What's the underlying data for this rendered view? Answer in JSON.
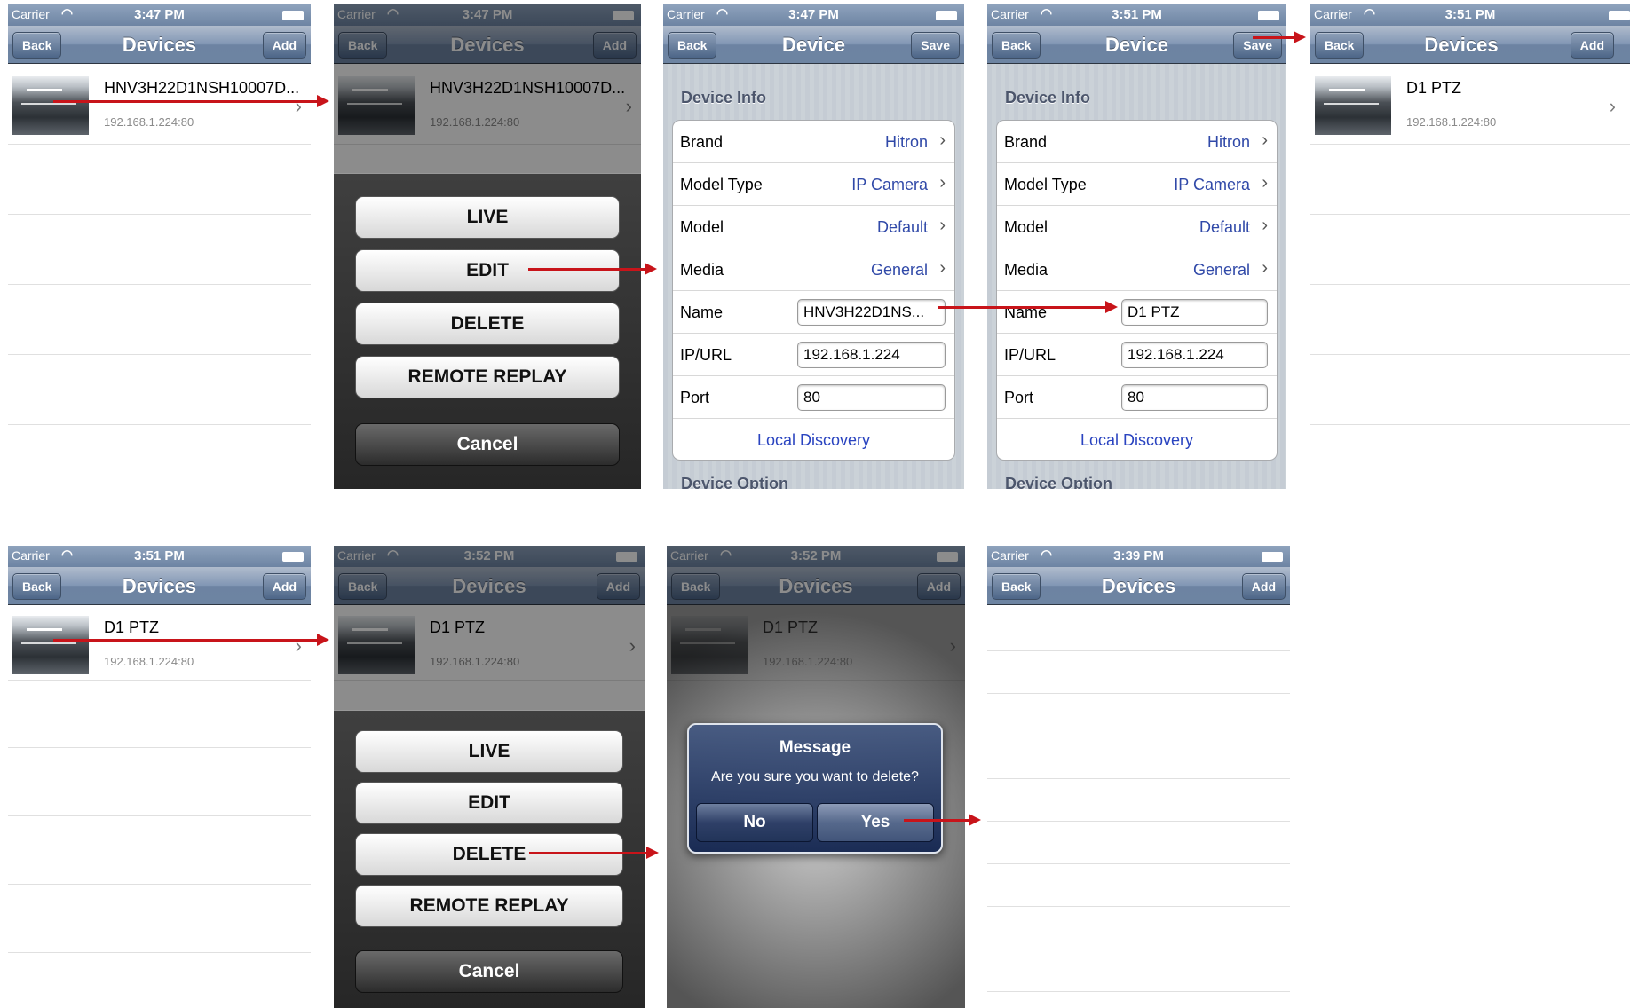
{
  "status": {
    "carrier": "Carrier",
    "wifi_icon": "wifi-icon",
    "battery_icon": "battery-icon"
  },
  "nav": {
    "back": "Back",
    "add": "Add",
    "save": "Save",
    "devices_title": "Devices",
    "device_title": "Device"
  },
  "times": {
    "t347": "3:47 PM",
    "t351": "3:51 PM",
    "t352": "3:52 PM",
    "t339": "3:39 PM"
  },
  "devices": {
    "original_name": "HNV3H22D1NSH10007D...",
    "renamed": "D1 PTZ",
    "ip": "192.168.1.224:80"
  },
  "action_sheet": {
    "live": "LIVE",
    "edit": "EDIT",
    "delete": "DELETE",
    "remote_replay": "REMOTE REPLAY",
    "cancel": "Cancel"
  },
  "form": {
    "section_info": "Device Info",
    "section_option": "Device Option",
    "brand_label": "Brand",
    "brand_value": "Hitron",
    "model_type_label": "Model Type",
    "model_type_value": "IP Camera",
    "model_label": "Model",
    "model_value": "Default",
    "media_label": "Media",
    "media_value": "General",
    "name_label": "Name",
    "name_value_before": "HNV3H22D1NS...",
    "name_value_after": "D1 PTZ",
    "ip_label": "IP/URL",
    "ip_value": "192.168.1.224",
    "port_label": "Port",
    "port_value": "80",
    "local_discovery": "Local Discovery"
  },
  "alert": {
    "title": "Message",
    "message": "Are you sure you want to delete?",
    "no": "No",
    "yes": "Yes"
  },
  "colors": {
    "arrow": "#c8141a",
    "nav_bar": "#6d84a2",
    "link_blue": "#2a44c0"
  }
}
